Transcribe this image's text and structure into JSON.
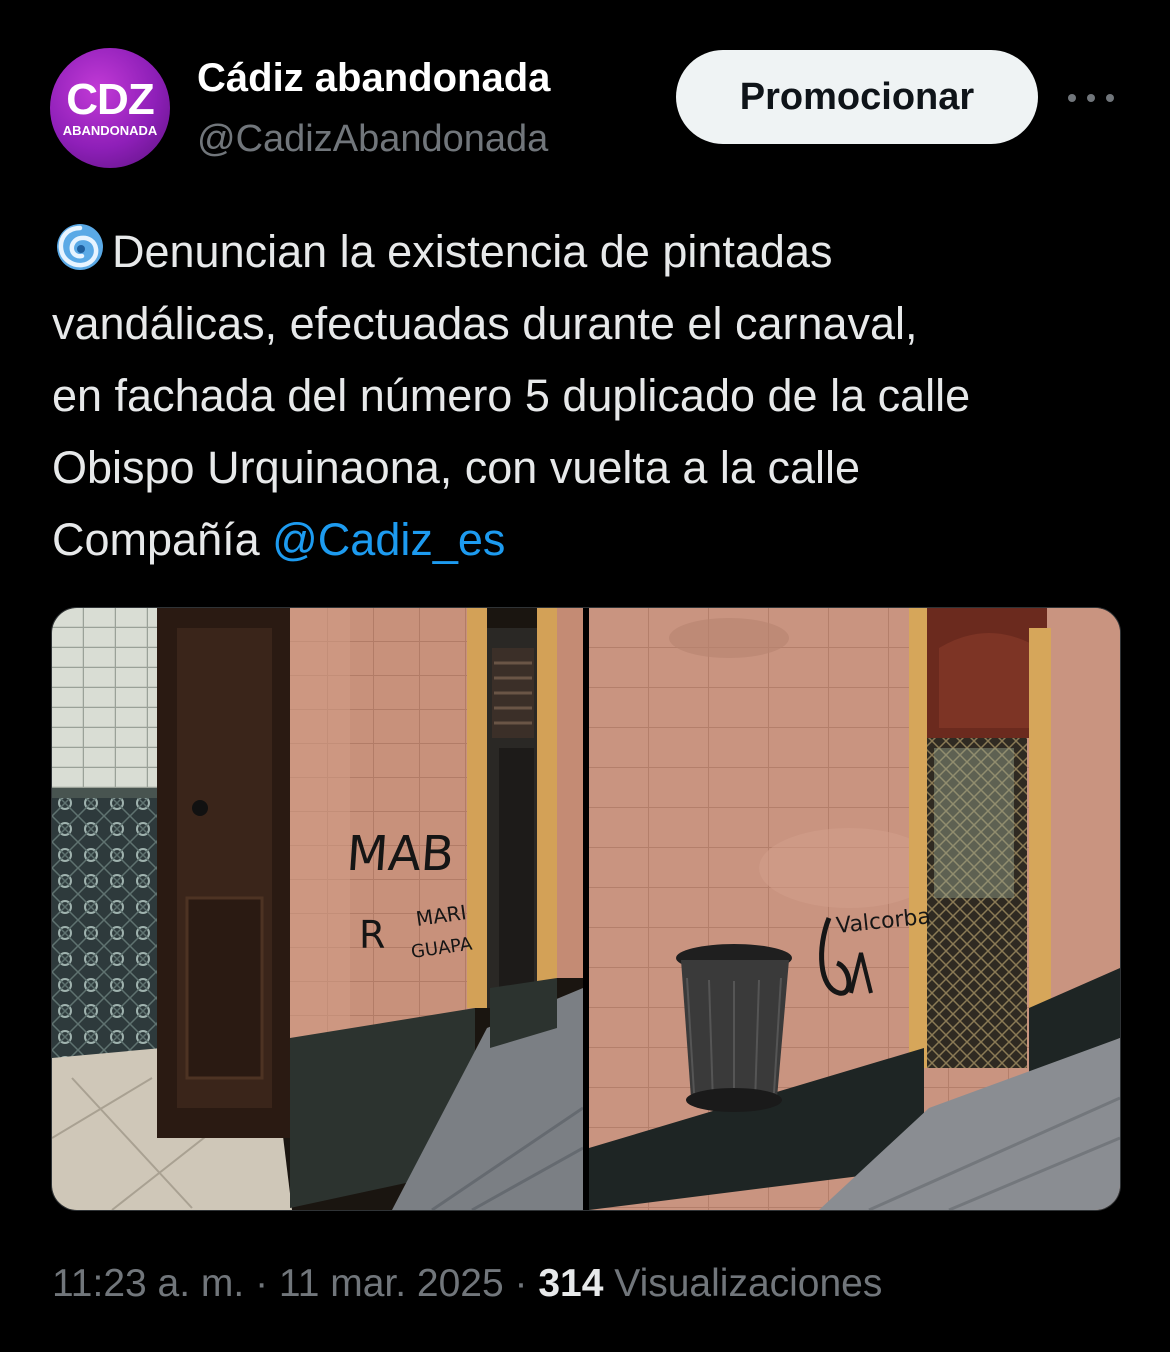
{
  "account": {
    "avatar_text_main": "CDZ",
    "avatar_text_sub": "ABANDONADA",
    "display_name": "Cádiz abandonada",
    "handle": "@CadizAbandonada"
  },
  "actions": {
    "promote_label": "Promocionar",
    "more_icon": "more-horizontal-icon"
  },
  "tweet": {
    "emoji": "cyclone-icon",
    "text_line1": "Denuncian la existencia de pintadas",
    "text_line2": "vandálicas, efectuadas durante el carnaval,",
    "text_line3": "en fachada del número 5 duplicado de la calle",
    "text_line4": "Obispo Urquinaona, con vuelta a la calle",
    "text_line5": "Compañía ",
    "mention": "@Cadiz_es"
  },
  "media": {
    "photo1_graffiti_a": "MAB",
    "photo1_graffiti_b": "R",
    "photo1_graffiti_c": "MARI",
    "photo1_graffiti_d": "GUAPA",
    "photo2_graffiti": "Valcorba"
  },
  "meta": {
    "time": "11:23 a. m.",
    "date": "11 mar. 2025",
    "separator": " · ",
    "views_count": "314",
    "views_label": "Visualizaciones"
  },
  "colors": {
    "background": "#000000",
    "accent": "#1d9bf0",
    "secondary_text": "#71767b",
    "avatar": "#8e1fb8"
  }
}
